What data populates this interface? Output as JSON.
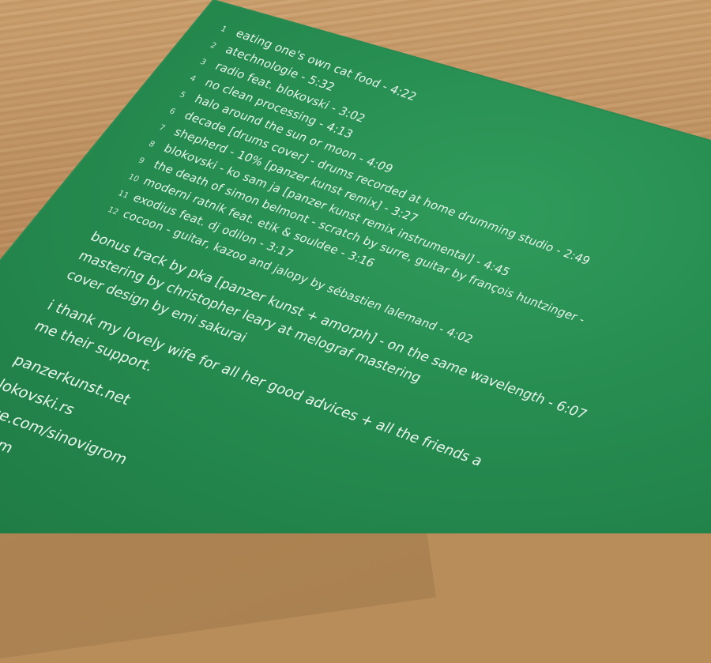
{
  "tracks": [
    {
      "num": "1",
      "title": "eating one's own cat food - 4:22"
    },
    {
      "num": "2",
      "title": "atechnologie - 5:32"
    },
    {
      "num": "3",
      "title": "radio feat. blokovski - 3:02"
    },
    {
      "num": "4",
      "title": "no clean processing - 4:13"
    },
    {
      "num": "5",
      "title": "halo around the sun or moon - 4:09"
    },
    {
      "num": "6",
      "title": "decade [drums cover] - drums recorded at home drumming studio - 2:49"
    },
    {
      "num": "7",
      "title": "shepherd - 10% [panzer kunst remix] - 3:27"
    },
    {
      "num": "8",
      "title": "blokovski - ko sam ja [panzer kunst remix instrumental] - 4:45"
    },
    {
      "num": "9",
      "title": "the death of simon belmont - scratch by surre, guitar by françois huntzinger -"
    },
    {
      "num": "10",
      "title": "moderni ratnik feat. etik & souldee - 3:16"
    },
    {
      "num": "11",
      "title": "exodius feat. dj odilon - 3:17"
    },
    {
      "num": "12",
      "title": "cocoon - guitar, kazoo and jalopy by sébastien lalemand - 4:02"
    }
  ],
  "credits": [
    "bonus track by pka [panzer kunst + amorph] - on the same wavelength - 6:07",
    "mastering by christopher leary at melograf mastering",
    "cover design by emi sakurai"
  ],
  "thanks": [
    "i thank my lovely wife for all her good advices + all the friends a",
    "me their support."
  ],
  "links": [
    "panzerkunst.net",
    "lokovski.rs",
    "ace.com/sinovigrom",
    "n.com"
  ]
}
